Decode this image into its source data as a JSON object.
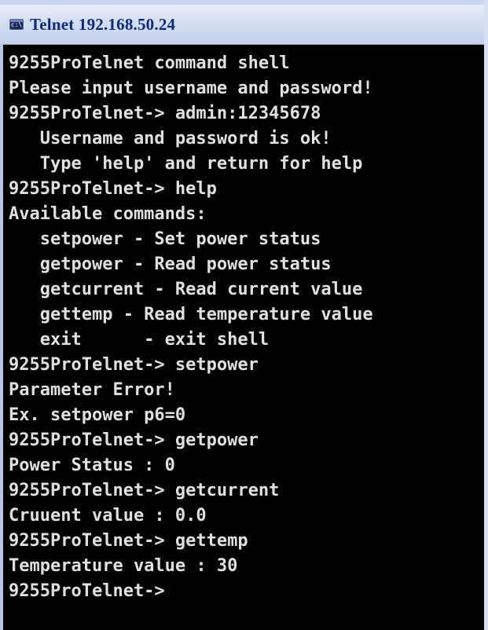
{
  "window": {
    "title": "Telnet 192.168.50.24",
    "icon": "console-window-icon",
    "icon_glyph": "c:\\"
  },
  "console": {
    "lines": [
      "9255ProTelnet command shell",
      "Please input username and password!",
      "9255ProTelnet-> admin:12345678",
      "   Username and password is ok!",
      "   Type 'help' and return for help",
      "9255ProTelnet-> help",
      "Available commands:",
      "   setpower - Set power status",
      "   getpower - Read power status",
      "   getcurrent - Read current value",
      "   gettemp - Read temperature value",
      "   exit      - exit shell",
      "9255ProTelnet-> setpower",
      "Parameter Error!",
      "Ex. setpower p6=0",
      "9255ProTelnet-> getpower",
      "Power Status : 0",
      "9255ProTelnet-> getcurrent",
      "Cruuent value : 0.0",
      "9255ProTelnet-> gettemp",
      "Temperature value : 30",
      "9255ProTelnet->"
    ]
  }
}
